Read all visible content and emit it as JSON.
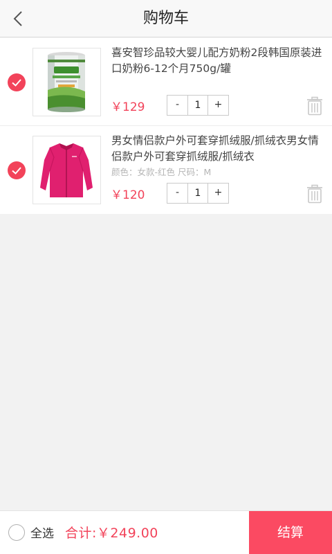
{
  "header": {
    "title": "购物车"
  },
  "items": [
    {
      "title": "喜安智珍品较大婴儿配方奶粉2段韩国原装进口奶粉6-12个月750g/罐",
      "spec": "",
      "price": "￥129",
      "quantity": "1",
      "minus": "-",
      "plus": "+",
      "checked": true
    },
    {
      "title": "男女情侣款户外可套穿抓绒服/抓绒衣男女情侣款户外可套穿抓绒服/抓绒衣",
      "spec": "颜色：女款-红色   尺码：M",
      "price": "￥120",
      "quantity": "1",
      "minus": "-",
      "plus": "+",
      "checked": true
    }
  ],
  "footer": {
    "select_all_label": "全选",
    "total": "合计:￥249.00",
    "checkout_label": "结算"
  },
  "colors": {
    "accent": "#f2435a",
    "checkout_bg": "#fb4a62"
  }
}
